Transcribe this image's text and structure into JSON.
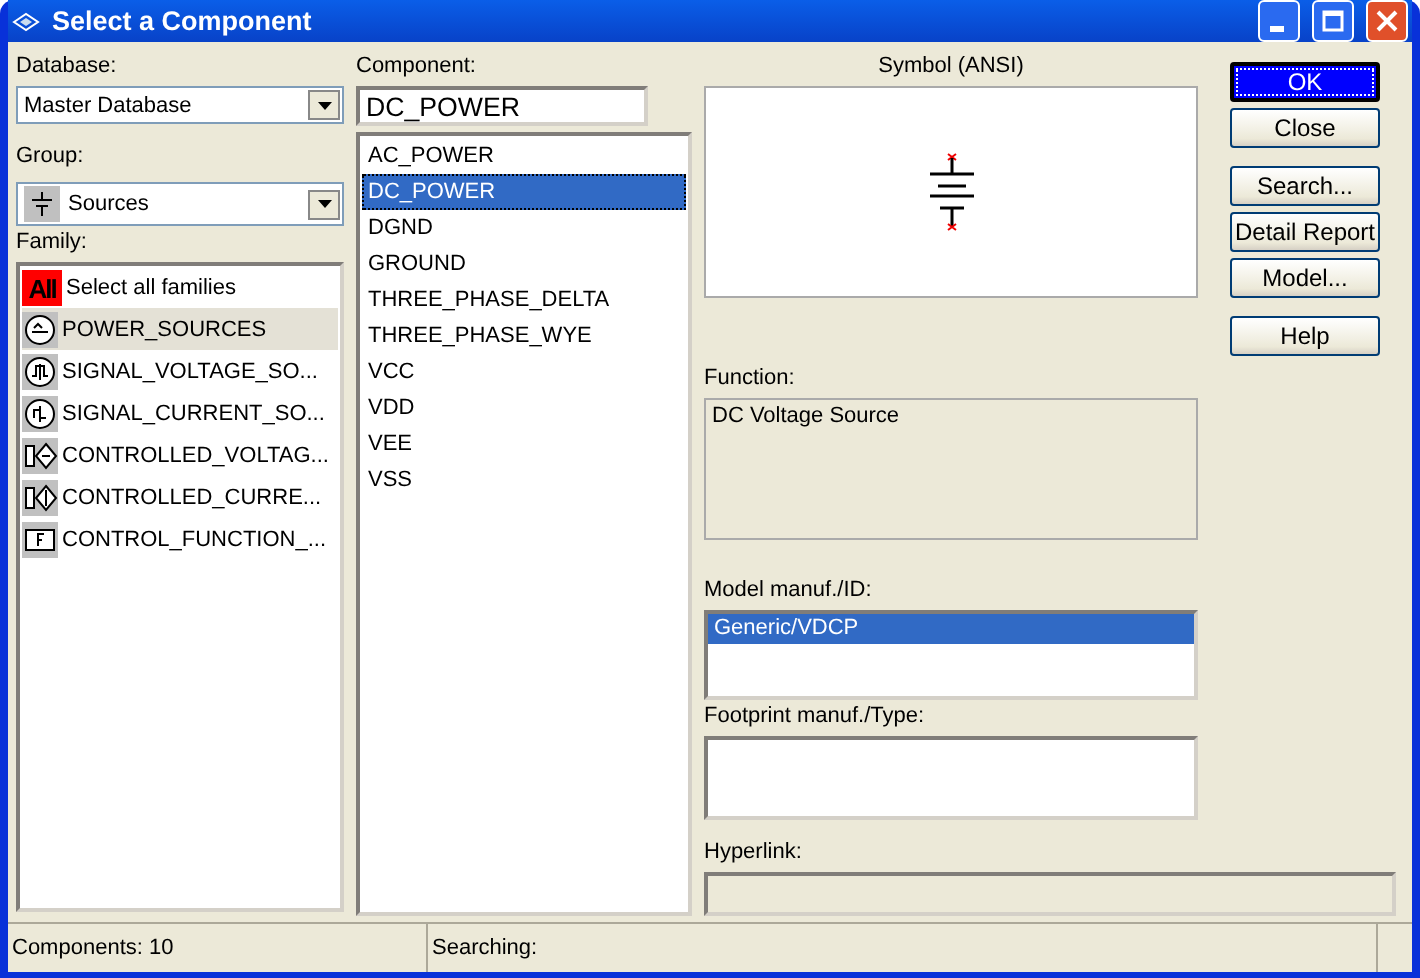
{
  "window": {
    "title": "Select a Component"
  },
  "database": {
    "label": "Database:",
    "value": "Master Database"
  },
  "group": {
    "label": "Group:",
    "value": "Sources"
  },
  "family": {
    "label": "Family:",
    "items": [
      {
        "badge": "All",
        "label": "Select all families",
        "selected": false
      },
      {
        "label": "POWER_SOURCES",
        "selected": true
      },
      {
        "label": "SIGNAL_VOLTAGE_SO...",
        "selected": false
      },
      {
        "label": "SIGNAL_CURRENT_SO...",
        "selected": false
      },
      {
        "label": "CONTROLLED_VOLTAG...",
        "selected": false
      },
      {
        "label": "CONTROLLED_CURRE...",
        "selected": false
      },
      {
        "label": "CONTROL_FUNCTION_...",
        "selected": false
      }
    ]
  },
  "component": {
    "label": "Component:",
    "value": "DC_POWER",
    "items": [
      {
        "label": "AC_POWER",
        "selected": false
      },
      {
        "label": "DC_POWER",
        "selected": true
      },
      {
        "label": "DGND",
        "selected": false
      },
      {
        "label": "GROUND",
        "selected": false
      },
      {
        "label": "THREE_PHASE_DELTA",
        "selected": false
      },
      {
        "label": "THREE_PHASE_WYE",
        "selected": false
      },
      {
        "label": "VCC",
        "selected": false
      },
      {
        "label": "VDD",
        "selected": false
      },
      {
        "label": "VEE",
        "selected": false
      },
      {
        "label": "VSS",
        "selected": false
      }
    ]
  },
  "symbol": {
    "label": "Symbol (ANSI)"
  },
  "function": {
    "label": "Function:",
    "value": "DC Voltage Source"
  },
  "model": {
    "label": "Model manuf./ID:",
    "items": [
      {
        "label": "Generic/VDCP",
        "selected": true
      }
    ]
  },
  "footprint": {
    "label": "Footprint manuf./Type:"
  },
  "hyperlink": {
    "label": "Hyperlink:"
  },
  "button_groups": [
    [
      {
        "label": "OK",
        "default": true
      },
      {
        "label": "Close",
        "default": false
      }
    ],
    [
      {
        "label": "Search...",
        "default": false
      },
      {
        "label": "Detail Report",
        "default": false
      },
      {
        "label": "Model...",
        "default": false
      }
    ],
    [
      {
        "label": "Help",
        "default": false
      }
    ]
  ],
  "status_bar": [
    "Components: 10",
    "Searching:"
  ]
}
